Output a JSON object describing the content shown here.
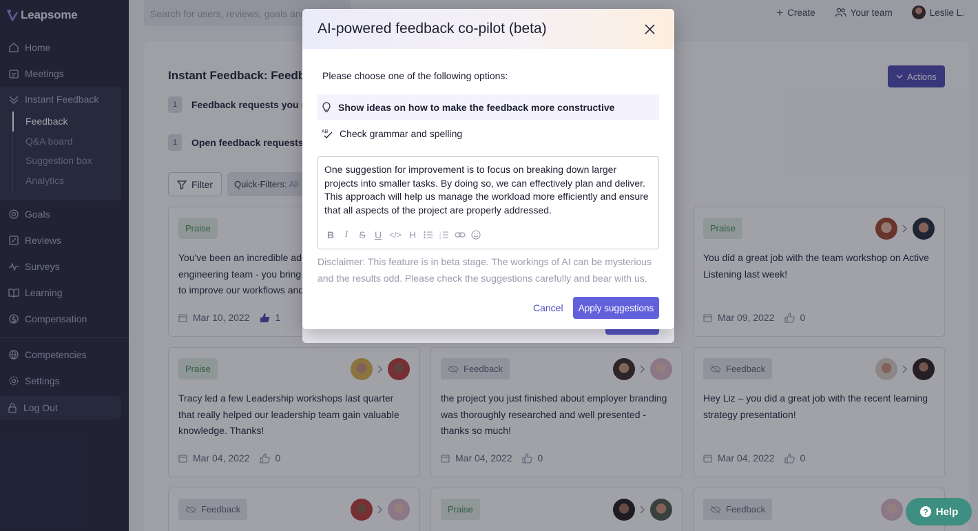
{
  "app": {
    "name": "Leapsome"
  },
  "sidebar": {
    "items": [
      {
        "label": "Home",
        "icon": "home-icon"
      },
      {
        "label": "Meetings",
        "icon": "meetings-icon"
      },
      {
        "label": "Instant Feedback",
        "icon": "feedback-icon"
      },
      {
        "label": "Goals",
        "icon": "goals-icon"
      },
      {
        "label": "Reviews",
        "icon": "reviews-icon"
      },
      {
        "label": "Surveys",
        "icon": "surveys-icon"
      },
      {
        "label": "Learning",
        "icon": "learning-icon"
      },
      {
        "label": "Compensation",
        "icon": "compensation-icon"
      },
      {
        "label": "Competencies",
        "icon": "competencies-icon"
      },
      {
        "label": "Settings",
        "icon": "settings-icon"
      }
    ],
    "sub_items": [
      {
        "label": "Feedback",
        "active": true
      },
      {
        "label": "Q&A board",
        "active": false
      },
      {
        "label": "Suggestion box",
        "active": false
      },
      {
        "label": "Analytics",
        "active": false
      }
    ],
    "logout_label": "Log Out"
  },
  "topbar": {
    "search_placeholder": "Search for users, reviews, goals and",
    "create_label": "Create",
    "team_label": "Your team",
    "user_name": "Leslie L."
  },
  "page": {
    "title": "Instant Feedback: Feedbac",
    "actions_label": "Actions",
    "requests": [
      {
        "count": "1",
        "label": "Feedback requests you re"
      },
      {
        "count": "1",
        "label": "Open feedback requests v"
      }
    ],
    "filter_label": "Filter",
    "quick_filters_label": "Quick-Filters:",
    "quick_filters_value": "All"
  },
  "cards": [
    {
      "type": "Praise",
      "text": "You've been an incredible addi engineering team - you bring g to improve our workflows and",
      "date": "Mar 10, 2022",
      "likes": "1",
      "liked": true
    },
    {
      "type": "Praise",
      "text": "You did a great job with the team workshop on Active Listening last week!",
      "date": "Mar 09, 2022",
      "likes": "0",
      "liked": false
    },
    {
      "type": "Praise",
      "text": "Tracy led a few Leadership workshops last quarter that really helped our leadership team gain valuable knowledge. Thanks!",
      "date": "Mar 04, 2022",
      "likes": "0",
      "liked": false
    },
    {
      "type": "Feedback",
      "text": "the project you just finished about employer branding was thoroughly researched and well presented - thanks so much!",
      "date": "Mar 04, 2022",
      "likes": "0",
      "liked": false
    },
    {
      "type": "Feedback",
      "text": "Hey Liz – you did a great job with the recent learning strategy presentation!",
      "date": "Mar 04, 2022",
      "likes": "0",
      "liked": false
    },
    {
      "type": "Feedback"
    },
    {
      "type": "Praise"
    },
    {
      "type": "Feedback"
    }
  ],
  "modal": {
    "title": "AI-powered feedback co-pilot (beta)",
    "prompt": "Please choose one of the following options:",
    "options": [
      {
        "label": "Show ideas on how to make the feedback more constructive",
        "icon": "lightbulb-icon",
        "selected": true
      },
      {
        "label": "Check grammar and spelling",
        "icon": "spellcheck-icon",
        "selected": false
      }
    ],
    "editor_text": "One suggestion for improvement is to focus on breaking down larger projects into smaller tasks. By doing so, we can effectively plan and deliver. This approach will help us manage the workload more efficiently and ensure that all aspects of the project are properly addressed.",
    "toolbar": [
      "bold-icon",
      "italic-icon",
      "strikethrough-icon",
      "underline-icon",
      "code-icon",
      "heading-icon",
      "bullet-list-icon",
      "numbered-list-icon",
      "link-icon",
      "emoji-icon"
    ],
    "disclaimer": "Disclaimer: This feature is in beta stage. The workings of AI can be mysterious and the results odd. Please check the suggestions carefully and bear with us.",
    "cancel_label": "Cancel",
    "apply_label": "Apply suggestions"
  },
  "help": {
    "label": "Help"
  },
  "colors": {
    "sidebar_bg": "#23263a",
    "accent": "#6360db",
    "praise_bg": "#e1eee2",
    "praise_text": "#3f8c50",
    "help_bg": "#3f8e82"
  }
}
